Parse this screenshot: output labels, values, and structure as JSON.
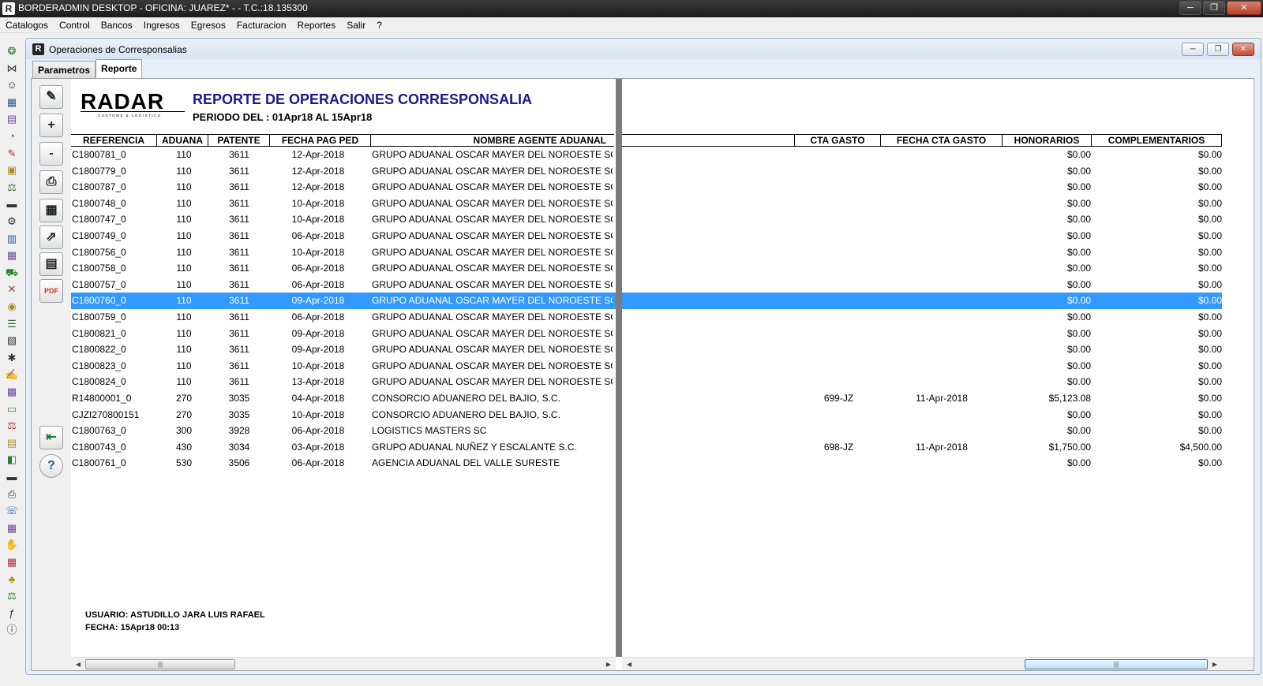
{
  "app": {
    "title": "BORDERADMIN DESKTOP - OFICINA: JUAREZ* -  - T.C.:18.135300",
    "icon_letter": "R"
  },
  "menu": [
    "Catalogos",
    "Control",
    "Bancos",
    "Ingresos",
    "Egresos",
    "Facturacion",
    "Reportes",
    "Salir",
    "?"
  ],
  "child": {
    "title": "Operaciones de Corresponsalias",
    "tabs": [
      "Parametros",
      "Reporte"
    ],
    "active_tab": "Reporte"
  },
  "report": {
    "logo_text": "RADAR",
    "logo_tagline": "CUSTOMS & LOGISTICS",
    "title": "REPORTE DE OPERACIONES CORRESPONSALIA",
    "period": "PERIODO DEL : 01Apr18 AL 15Apr18",
    "headers": {
      "referencia": "REFERENCIA",
      "aduana": "ADUANA",
      "patente": "PATENTE",
      "fecha_pag_ped": "FECHA PAG PED",
      "nombre_agente": "NOMBRE AGENTE ADUANAL",
      "cta_gasto": "CTA GASTO",
      "fecha_cta_gasto": "FECHA CTA GASTO",
      "honorarios": "HONORARIOS",
      "complementarios": "COMPLEMENTARIOS"
    },
    "rows": [
      {
        "ref": "C1800781_0",
        "aduana": "110",
        "patente": "3611",
        "fecha": "12-Apr-2018",
        "nombre": "GRUPO ADUANAL OSCAR MAYER DEL NOROESTE SC",
        "cta": "",
        "fcta": "",
        "hon": "$0.00",
        "com": "$0.00"
      },
      {
        "ref": "C1800779_0",
        "aduana": "110",
        "patente": "3611",
        "fecha": "12-Apr-2018",
        "nombre": "GRUPO ADUANAL OSCAR MAYER DEL NOROESTE SC",
        "cta": "",
        "fcta": "",
        "hon": "$0.00",
        "com": "$0.00"
      },
      {
        "ref": "C1800787_0",
        "aduana": "110",
        "patente": "3611",
        "fecha": "12-Apr-2018",
        "nombre": "GRUPO ADUANAL OSCAR MAYER DEL NOROESTE SC",
        "cta": "",
        "fcta": "",
        "hon": "$0.00",
        "com": "$0.00"
      },
      {
        "ref": "C1800748_0",
        "aduana": "110",
        "patente": "3611",
        "fecha": "10-Apr-2018",
        "nombre": "GRUPO ADUANAL OSCAR MAYER DEL NOROESTE SC",
        "cta": "",
        "fcta": "",
        "hon": "$0.00",
        "com": "$0.00"
      },
      {
        "ref": "C1800747_0",
        "aduana": "110",
        "patente": "3611",
        "fecha": "10-Apr-2018",
        "nombre": "GRUPO ADUANAL OSCAR MAYER DEL NOROESTE SC",
        "cta": "",
        "fcta": "",
        "hon": "$0.00",
        "com": "$0.00"
      },
      {
        "ref": "C1800749_0",
        "aduana": "110",
        "patente": "3611",
        "fecha": "06-Apr-2018",
        "nombre": "GRUPO ADUANAL OSCAR MAYER DEL NOROESTE SC",
        "cta": "",
        "fcta": "",
        "hon": "$0.00",
        "com": "$0.00"
      },
      {
        "ref": "C1800756_0",
        "aduana": "110",
        "patente": "3611",
        "fecha": "10-Apr-2018",
        "nombre": "GRUPO ADUANAL OSCAR MAYER DEL NOROESTE SC",
        "cta": "",
        "fcta": "",
        "hon": "$0.00",
        "com": "$0.00"
      },
      {
        "ref": "C1800758_0",
        "aduana": "110",
        "patente": "3611",
        "fecha": "06-Apr-2018",
        "nombre": "GRUPO ADUANAL OSCAR MAYER DEL NOROESTE SC",
        "cta": "",
        "fcta": "",
        "hon": "$0.00",
        "com": "$0.00"
      },
      {
        "ref": "C1800757_0",
        "aduana": "110",
        "patente": "3611",
        "fecha": "06-Apr-2018",
        "nombre": "GRUPO ADUANAL OSCAR MAYER DEL NOROESTE SC",
        "cta": "",
        "fcta": "",
        "hon": "$0.00",
        "com": "$0.00"
      },
      {
        "ref": "C1800760_0",
        "aduana": "110",
        "patente": "3611",
        "fecha": "09-Apr-2018",
        "nombre": "GRUPO ADUANAL OSCAR MAYER DEL NOROESTE SC",
        "cta": "",
        "fcta": "",
        "hon": "$0.00",
        "com": "$0.00",
        "selected": true
      },
      {
        "ref": "C1800759_0",
        "aduana": "110",
        "patente": "3611",
        "fecha": "06-Apr-2018",
        "nombre": "GRUPO ADUANAL OSCAR MAYER DEL NOROESTE SC",
        "cta": "",
        "fcta": "",
        "hon": "$0.00",
        "com": "$0.00"
      },
      {
        "ref": "C1800821_0",
        "aduana": "110",
        "patente": "3611",
        "fecha": "09-Apr-2018",
        "nombre": "GRUPO ADUANAL OSCAR MAYER DEL NOROESTE SC",
        "cta": "",
        "fcta": "",
        "hon": "$0.00",
        "com": "$0.00"
      },
      {
        "ref": "C1800822_0",
        "aduana": "110",
        "patente": "3611",
        "fecha": "09-Apr-2018",
        "nombre": "GRUPO ADUANAL OSCAR MAYER DEL NOROESTE SC",
        "cta": "",
        "fcta": "",
        "hon": "$0.00",
        "com": "$0.00"
      },
      {
        "ref": "C1800823_0",
        "aduana": "110",
        "patente": "3611",
        "fecha": "10-Apr-2018",
        "nombre": "GRUPO ADUANAL OSCAR MAYER DEL NOROESTE SC",
        "cta": "",
        "fcta": "",
        "hon": "$0.00",
        "com": "$0.00"
      },
      {
        "ref": "C1800824_0",
        "aduana": "110",
        "patente": "3611",
        "fecha": "13-Apr-2018",
        "nombre": "GRUPO ADUANAL OSCAR MAYER DEL NOROESTE SC",
        "cta": "",
        "fcta": "",
        "hon": "$0.00",
        "com": "$0.00"
      },
      {
        "ref": "R14800001_0",
        "aduana": "270",
        "patente": "3035",
        "fecha": "04-Apr-2018",
        "nombre": "CONSORCIO ADUANERO DEL BAJIO, S.C.",
        "cta": "699-JZ",
        "fcta": "11-Apr-2018",
        "hon": "$5,123.08",
        "com": "$0.00"
      },
      {
        "ref": "CJZI270800151",
        "aduana": "270",
        "patente": "3035",
        "fecha": "10-Apr-2018",
        "nombre": "CONSORCIO ADUANERO DEL BAJIO, S.C.",
        "cta": "",
        "fcta": "",
        "hon": "$0.00",
        "com": "$0.00"
      },
      {
        "ref": "C1800763_0",
        "aduana": "300",
        "patente": "3928",
        "fecha": "06-Apr-2018",
        "nombre": "LOGISTICS MASTERS SC",
        "cta": "",
        "fcta": "",
        "hon": "$0.00",
        "com": "$0.00"
      },
      {
        "ref": "C1800743_0",
        "aduana": "430",
        "patente": "3034",
        "fecha": "03-Apr-2018",
        "nombre": "GRUPO ADUANAL NUÑEZ Y ESCALANTE S.C.",
        "cta": "698-JZ",
        "fcta": "11-Apr-2018",
        "hon": "$1,750.00",
        "com": "$4,500.00"
      },
      {
        "ref": "C1800761_0",
        "aduana": "530",
        "patente": "3506",
        "fecha": "06-Apr-2018",
        "nombre": "AGENCIA ADUANAL DEL VALLE SURESTE",
        "cta": "",
        "fcta": "",
        "hon": "$0.00",
        "com": "$0.00"
      }
    ],
    "footer_user": "USUARIO: ASTUDILLO JARA LUIS RAFAEL",
    "footer_date": "FECHA: 15Apr18 00:13"
  },
  "report_toolbar": [
    {
      "name": "refresh-tool-icon",
      "glyph": "✎"
    },
    {
      "name": "zoom-in-button",
      "glyph": "+"
    },
    {
      "name": "zoom-out-button",
      "glyph": "-"
    },
    {
      "name": "print-icon",
      "glyph": "⎙"
    },
    {
      "name": "export-excel-icon",
      "glyph": "▦"
    },
    {
      "name": "export-icon",
      "glyph": "⇗"
    },
    {
      "name": "print-preview-icon",
      "glyph": "▤"
    },
    {
      "name": "pdf-icon",
      "glyph": "PDF"
    },
    {
      "name": "exit-door-icon",
      "glyph": "⇤"
    },
    {
      "name": "help-icon",
      "glyph": "?"
    }
  ],
  "left_toolbar": [
    "money-bag-icon",
    "formula-icon",
    "user-icon",
    "calculator-icon",
    "document-icon",
    "bag-icon",
    "pen-icon",
    "id-card-icon",
    "scale-icon",
    "ruler-icon",
    "gear-user-icon",
    "books-icon",
    "gold-icon",
    "truck-icon",
    "xy-icon",
    "database-icon",
    "stack-icon",
    "search-doc-icon",
    "settings-icon",
    "user-edit-icon",
    "grid-icon",
    "list-icon",
    "scale2-icon",
    "green-card-icon",
    "box-icon",
    "money-icon",
    "print-doc-icon",
    "chat-icon",
    "network-icon",
    "hand-icon",
    "binary-icon",
    "club-icon",
    "scale3-icon",
    "function-icon",
    "info-icon"
  ],
  "colors": {
    "selection": "#3399ff",
    "report_title": "#1a1a8a",
    "split_bar": "#7c7c7c"
  }
}
